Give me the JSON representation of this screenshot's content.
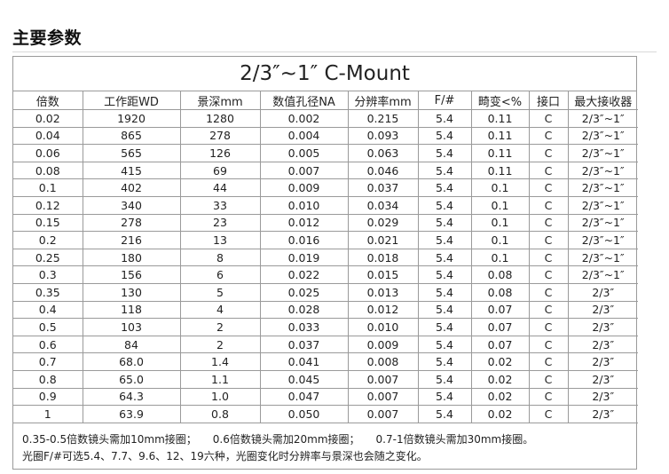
{
  "page": {
    "heading": "主要参数"
  },
  "table": {
    "title": "2/3″~1″   C-Mount",
    "columns": [
      "倍数",
      "工作距WD",
      "景深mm",
      "数值孔径NA",
      "分辨率mm",
      "F/#",
      "畸变<%",
      "接口",
      "最大接收器"
    ],
    "rows": [
      [
        "0.02",
        "1920",
        "1280",
        "0.002",
        "0.215",
        "5.4",
        "0.11",
        "C",
        "2/3″~1″"
      ],
      [
        "0.04",
        "865",
        "278",
        "0.004",
        "0.093",
        "5.4",
        "0.11",
        "C",
        "2/3″~1″"
      ],
      [
        "0.06",
        "565",
        "126",
        "0.005",
        "0.063",
        "5.4",
        "0.11",
        "C",
        "2/3″~1″"
      ],
      [
        "0.08",
        "415",
        "69",
        "0.007",
        "0.046",
        "5.4",
        "0.11",
        "C",
        "2/3″~1″"
      ],
      [
        "0.1",
        "402",
        "44",
        "0.009",
        "0.037",
        "5.4",
        "0.1",
        "C",
        "2/3″~1″"
      ],
      [
        "0.12",
        "340",
        "33",
        "0.010",
        "0.034",
        "5.4",
        "0.1",
        "C",
        "2/3″~1″"
      ],
      [
        "0.15",
        "278",
        "23",
        "0.012",
        "0.029",
        "5.4",
        "0.1",
        "C",
        "2/3″~1″"
      ],
      [
        "0.2",
        "216",
        "13",
        "0.016",
        "0.021",
        "5.4",
        "0.1",
        "C",
        "2/3″~1″"
      ],
      [
        "0.25",
        "180",
        "8",
        "0.019",
        "0.018",
        "5.4",
        "0.1",
        "C",
        "2/3″~1″"
      ],
      [
        "0.3",
        "156",
        "6",
        "0.022",
        "0.015",
        "5.4",
        "0.08",
        "C",
        "2/3″~1″"
      ],
      [
        "0.35",
        "130",
        "5",
        "0.025",
        "0.013",
        "5.4",
        "0.08",
        "C",
        "2/3″"
      ],
      [
        "0.4",
        "118",
        "4",
        "0.028",
        "0.012",
        "5.4",
        "0.07",
        "C",
        "2/3″"
      ],
      [
        "0.5",
        "103",
        "2",
        "0.033",
        "0.010",
        "5.4",
        "0.07",
        "C",
        "2/3″"
      ],
      [
        "0.6",
        "84",
        "2",
        "0.037",
        "0.009",
        "5.4",
        "0.07",
        "C",
        "2/3″"
      ],
      [
        "0.7",
        "68.0",
        "1.4",
        "0.041",
        "0.008",
        "5.4",
        "0.02",
        "C",
        "2/3″"
      ],
      [
        "0.8",
        "65.0",
        "1.1",
        "0.045",
        "0.007",
        "5.4",
        "0.02",
        "C",
        "2/3″"
      ],
      [
        "0.9",
        "64.3",
        "1.0",
        "0.047",
        "0.007",
        "5.4",
        "0.02",
        "C",
        "2/3″"
      ],
      [
        "1",
        "63.9",
        "0.8",
        "0.050",
        "0.007",
        "5.4",
        "0.02",
        "C",
        "2/3″"
      ]
    ]
  },
  "notes": {
    "line1_a": "0.35-0.5倍数镜头需加10mm接圈；",
    "line1_b": "0.6倍数镜头需加20mm接圈；",
    "line1_c": "0.7-1倍数镜头需加30mm接圈。",
    "line2": "光圈F/#可选5.4、7.7、9.6、12、19六种，光圈变化时分辨率与景深也会随之变化。"
  }
}
